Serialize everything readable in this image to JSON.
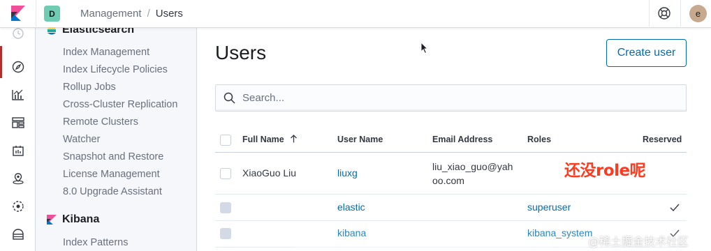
{
  "header": {
    "space_initial": "D",
    "breadcrumbs": [
      "Management",
      "Users"
    ],
    "user_initial": "e"
  },
  "sidenav": {
    "elasticsearch_title": "Elasticsearch",
    "elasticsearch_items": [
      "Index Management",
      "Index Lifecycle Policies",
      "Rollup Jobs",
      "Cross-Cluster Replication",
      "Remote Clusters",
      "Watcher",
      "Snapshot and Restore",
      "License Management",
      "8.0 Upgrade Assistant"
    ],
    "kibana_title": "Kibana",
    "kibana_items": [
      "Index Patterns"
    ]
  },
  "main": {
    "title": "Users",
    "create_button": "Create user",
    "search_placeholder": "Search..."
  },
  "table": {
    "columns": [
      "Full Name",
      "User Name",
      "Email Address",
      "Roles",
      "Reserved"
    ],
    "rows": [
      {
        "full_name": "XiaoGuo Liu",
        "user_name": "liuxg",
        "email_line1": "liu_xiao_guo@yah",
        "email_line2": "oo.com",
        "roles": "",
        "reserved": false
      },
      {
        "full_name": "",
        "user_name": "elastic",
        "email_line1": "",
        "email_line2": "",
        "roles": "superuser",
        "reserved": true
      },
      {
        "full_name": "",
        "user_name": "kibana",
        "email_line1": "",
        "email_line2": "",
        "roles": "kibana_system",
        "reserved": true
      }
    ]
  },
  "annotation": "还没role呢",
  "watermark": "@稀土掘金技术社区",
  "colors": {
    "link": "#006bb4",
    "annotation": "#ff3a1f",
    "space_avatar": "#6dccb1"
  }
}
